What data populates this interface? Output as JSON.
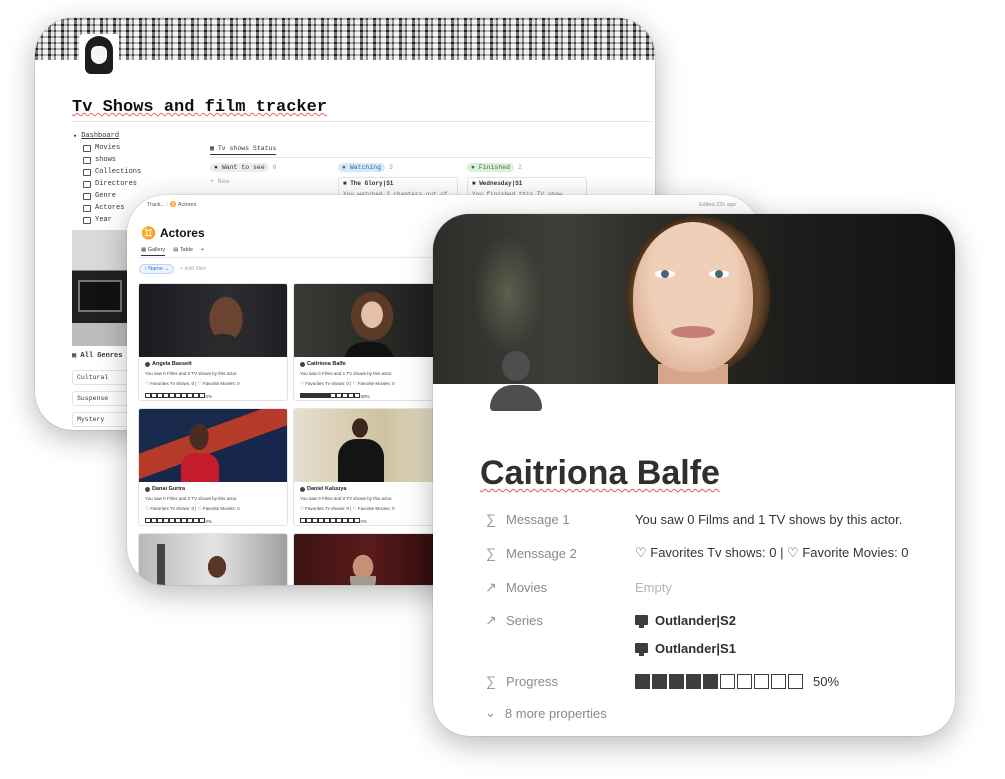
{
  "tracker": {
    "title": "Tv Shows and film tracker",
    "nav": {
      "dashboard": "Dashboard",
      "items": [
        "Movies",
        "shows",
        "Collections",
        "Directores",
        "Genre",
        "Actores",
        "Year"
      ]
    },
    "tab": "Tv shows Status",
    "columns": [
      {
        "status": "Want to see",
        "count": "0",
        "color": "#e8e8e8",
        "extra": "+ New"
      },
      {
        "status": "Watching",
        "count": "3",
        "color": "#d7e8f7",
        "card_title": "The Glory|S1",
        "card_text": "You watched 2 chapters out of 8"
      },
      {
        "status": "Finished",
        "count": "2",
        "color": "#dcefdc",
        "card_title": "Wednesday|S1",
        "card_text": "You finished this TV show"
      }
    ],
    "genres_label": "All Genres",
    "genres": [
      "Cultural",
      "Suspense",
      "Mystery"
    ]
  },
  "actores": {
    "breadcrumb_start": "Track...",
    "breadcrumb_page": "Actores",
    "edited": "Edited 22h ago",
    "title": "Actores",
    "views": [
      "Gallery",
      "Table",
      "+"
    ],
    "filter_name": "Name",
    "add_filter": "+ Add filter",
    "cards": [
      {
        "name": "Angela Bassett",
        "line1": "You saw 0 Films and 0 TV shows by this actor.",
        "line2": "♡ Favorites Tv shows: 0 | ♡ Favorite Movies: 0",
        "progress": "0%",
        "filled": 0
      },
      {
        "name": "Caitriona Balfe",
        "line1": "You saw 0 Films and 1 TV shows by this actor.",
        "line2": "♡ Favorites Tv shows: 0 | ♡ Favorite Movies: 0",
        "progress": "50%",
        "filled": 5
      },
      {
        "name": "Danai Gurira",
        "line1": "You saw 0 Films and 0 TV shows by this actor.",
        "line2": "♡ Favorites Tv shows: 0 | ♡ Favorite Movies: 0",
        "progress": "0%",
        "filled": 0
      },
      {
        "name": "Daniel Kaluuya",
        "line1": "You saw 0 Films and 0 TV shows by this actor.",
        "line2": "♡ Favorites Tv shows: 0 | ♡ Favorite Movies: 0",
        "progress": "0%",
        "filled": 0
      }
    ]
  },
  "detail": {
    "title": "Caitriona Balfe",
    "properties": {
      "message1": {
        "label": "Message 1",
        "value": "You saw 0 Films and 1 TV shows by this actor."
      },
      "message2": {
        "label": "Menssage 2",
        "value": "♡ Favorites Tv shows: 0 | ♡ Favorite Movies: 0"
      },
      "movies": {
        "label": "Movies",
        "value": "Empty"
      },
      "series": {
        "label": "Series",
        "values": [
          "Outlander|S2",
          "Outlander|S1"
        ]
      },
      "progress": {
        "label": "Progress",
        "value": "50%",
        "filled": 5,
        "total": 10
      }
    },
    "more": "8 more properties",
    "icons": {
      "formula": "sigma-icon",
      "relation": "arrow-up-right-icon",
      "more": "chevron-down-icon"
    }
  }
}
